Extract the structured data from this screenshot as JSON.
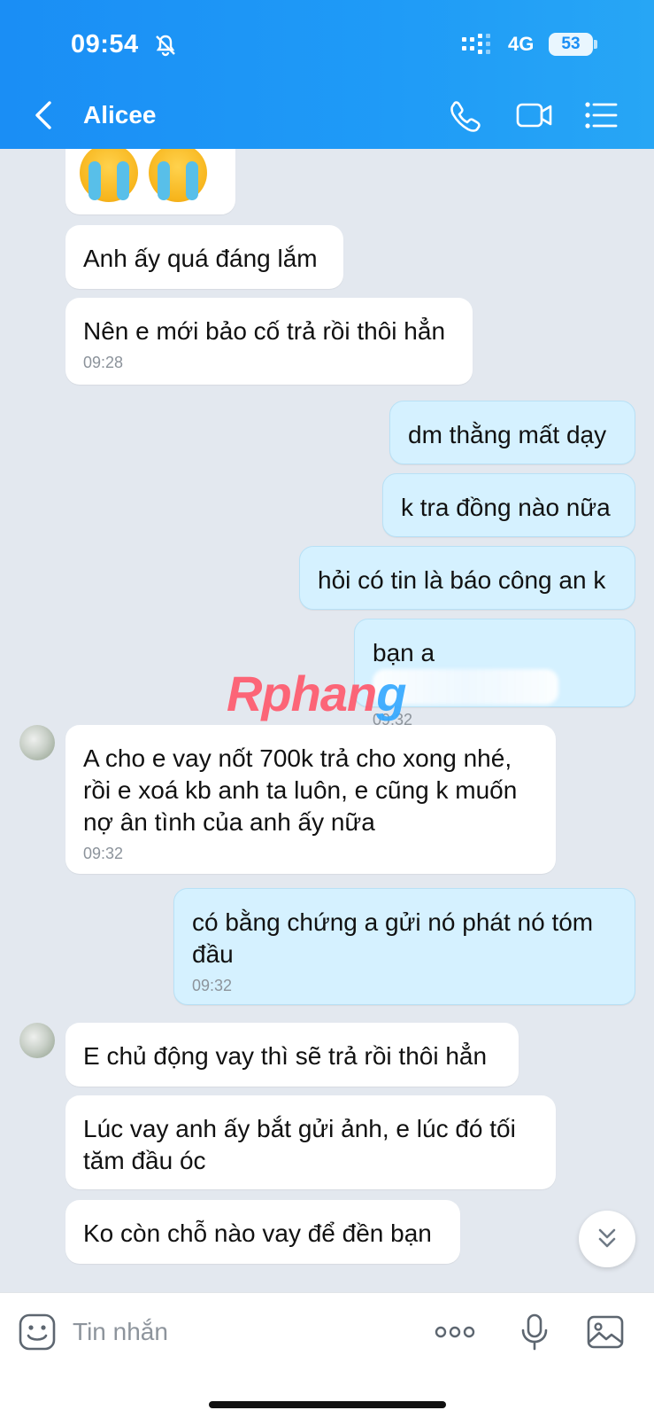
{
  "status": {
    "time": "09:54",
    "network": "4G",
    "battery": "53"
  },
  "header": {
    "title": "Alicee"
  },
  "messages": [
    {
      "side": "in",
      "text": "Anh ấy quá đáng lắm"
    },
    {
      "side": "in",
      "text": "Nên e mới bảo cố trả rồi thôi hẳn",
      "time": "09:28"
    },
    {
      "side": "out",
      "text": "dm thằng mất dạy"
    },
    {
      "side": "out",
      "text": "k tra đồng nào nữa"
    },
    {
      "side": "out",
      "text": "hỏi có tin là báo công an k"
    },
    {
      "side": "out",
      "text": "bạn a",
      "time": "09:32"
    },
    {
      "side": "in",
      "text": "A cho e vay nốt 700k trả cho xong nhé, rồi e xoá kb anh ta luôn, e cũng k muốn nợ ân tình của anh ấy nữa",
      "time": "09:32"
    },
    {
      "side": "out",
      "text": "có bằng chứng a gửi nó phát nó tóm đầu",
      "time": "09:32"
    },
    {
      "side": "in",
      "text": "E chủ động vay thì sẽ trả rồi thôi hẳn"
    },
    {
      "side": "in",
      "text": "Lúc vay anh ấy bắt gửi ảnh, e lúc đó tối tăm đầu óc"
    },
    {
      "side": "in",
      "text": "Ko còn chỗ nào vay để đền bạn"
    }
  ],
  "watermark": {
    "part1": "Rphan",
    "part2": "g"
  },
  "composer": {
    "placeholder": "Tin nhắn"
  }
}
